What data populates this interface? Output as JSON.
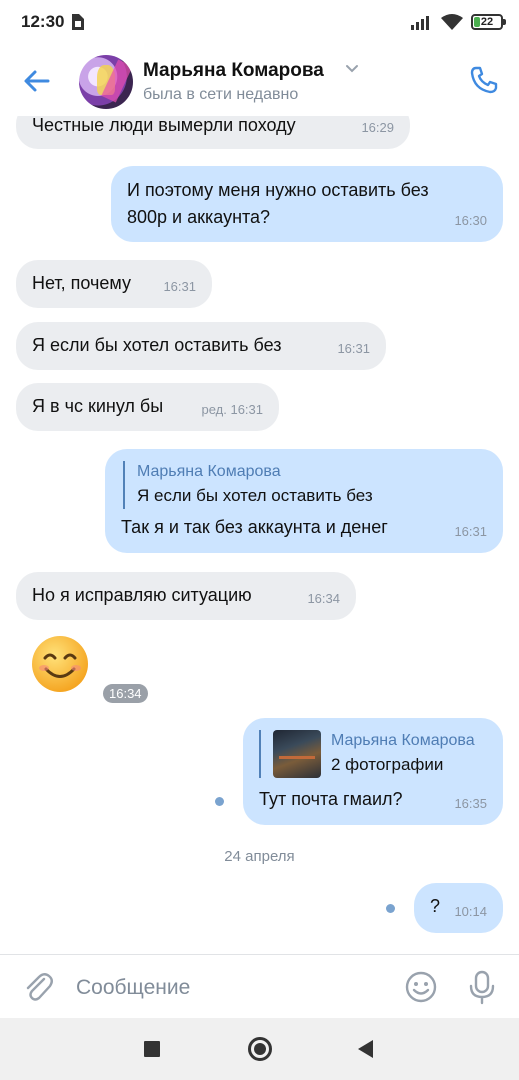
{
  "status_bar": {
    "time": "12:30",
    "battery": "22",
    "battery_level": 0.22
  },
  "header": {
    "name": "Марьяна Комарова",
    "status": "была в сети недавно"
  },
  "messages": [
    {
      "side": "in",
      "text": "Честные люди вымерли походу",
      "time": "16:29"
    },
    {
      "side": "out",
      "line1": "И поэтому меня нужно оставить без",
      "line2": "800р и аккаунта?",
      "time": "16:30"
    },
    {
      "side": "in",
      "text": "Нет, почему",
      "time": "16:31"
    },
    {
      "side": "in",
      "text": "Я если бы хотел оставить без",
      "time": "16:31"
    },
    {
      "side": "in",
      "text": "Я в чс кинул бы",
      "time": "ред. 16:31"
    },
    {
      "side": "out",
      "reply_name": "Марьяна Комарова",
      "reply_text": "Я если бы хотел оставить без",
      "text": "Так я и так без аккаунта и денег",
      "time": "16:31"
    },
    {
      "side": "in",
      "text": "Но я исправляю ситуацию",
      "time": "16:34"
    },
    {
      "side": "in",
      "emoji": "smiling-face",
      "time": "16:34"
    },
    {
      "side": "out",
      "reply_name": "Марьяна Комарова",
      "reply_text": "2 фотографии",
      "text": "Тут почта гмаил?",
      "time": "16:35"
    },
    {
      "side": "out",
      "text": "?",
      "time": "10:14"
    }
  ],
  "date_separator": "24 апреля",
  "composer": {
    "placeholder": "Сообщение"
  },
  "colors": {
    "accent": "#3f8ae0",
    "incoming_bubble": "#ebedf0",
    "outgoing_bubble": "#cce4ff",
    "secondary_text": "#818c99"
  },
  "icons": [
    "back-arrow-icon",
    "phone-icon",
    "chevron-down-icon",
    "paperclip-icon",
    "emoji-icon",
    "microphone-icon",
    "sim-icon",
    "signal-icon",
    "wifi-icon",
    "battery-icon"
  ]
}
